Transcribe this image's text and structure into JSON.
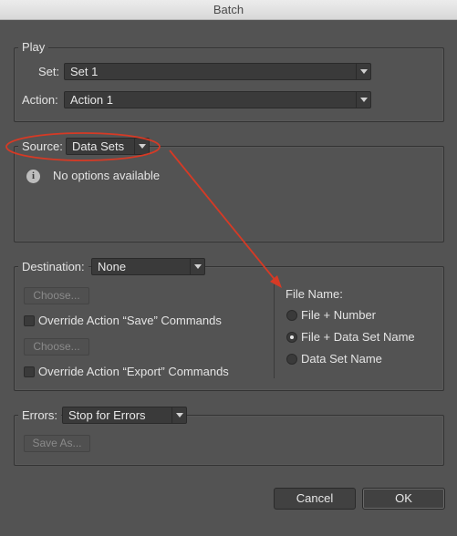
{
  "window": {
    "title": "Batch"
  },
  "play": {
    "legend": "Play",
    "set_label": "Set:",
    "set_value": "Set 1",
    "action_label": "Action:",
    "action_value": "Action 1"
  },
  "source": {
    "label": "Source:",
    "value": "Data Sets",
    "info_glyph": "i",
    "message": "No options available"
  },
  "destination": {
    "label": "Destination:",
    "value": "None",
    "choose1": "Choose...",
    "override_save": "Override Action “Save” Commands",
    "choose2": "Choose...",
    "override_export": "Override Action “Export” Commands",
    "file_name_label": "File Name:",
    "options": [
      "File + Number",
      "File + Data Set Name",
      "Data Set Name"
    ],
    "selected_index": 1
  },
  "errors": {
    "label": "Errors:",
    "value": "Stop for Errors",
    "save_as": "Save As..."
  },
  "buttons": {
    "cancel": "Cancel",
    "ok": "OK"
  },
  "colors": {
    "annotation": "#d63a25",
    "background": "#535353"
  }
}
